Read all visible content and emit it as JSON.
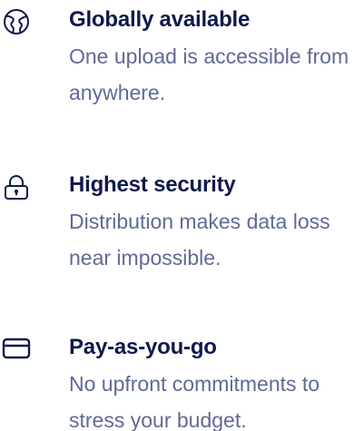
{
  "colors": {
    "title": "#0e1a4b",
    "description": "#5f6a96",
    "icon": "#0e1a4b",
    "background": "#ffffff"
  },
  "features": [
    {
      "icon": "globe-icon",
      "title": "Globally available",
      "description": "One upload is accessible from anywhere."
    },
    {
      "icon": "lock-icon",
      "title": "Highest security",
      "description": "Distribution makes data loss near impossible."
    },
    {
      "icon": "credit-card-icon",
      "title": "Pay-as-you-go",
      "description": "No upfront commitments to stress your budget."
    }
  ]
}
